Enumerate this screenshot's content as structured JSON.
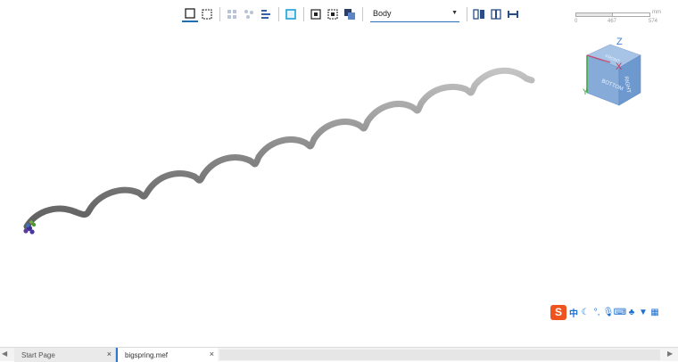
{
  "toolbar": {
    "select_value": "Body",
    "buttons": [
      {
        "name": "select-single-icon"
      },
      {
        "name": "select-box-icon"
      },
      {
        "name": "select-grid-icon"
      },
      {
        "name": "select-scatter-icon"
      },
      {
        "name": "align-list-icon"
      },
      {
        "name": "face-mode-icon"
      },
      {
        "name": "frame-1-icon"
      },
      {
        "name": "frame-2-icon"
      },
      {
        "name": "frame-3-icon"
      },
      {
        "name": "split-view-icon"
      },
      {
        "name": "column-view-icon"
      },
      {
        "name": "measure-icon"
      }
    ]
  },
  "scale": {
    "unit": "mm",
    "ticks": [
      "0",
      "467",
      "574"
    ]
  },
  "viewcube": {
    "axis_z": "Z",
    "axis_x": "X",
    "axis_y": "Y",
    "face_front": "BOTTOM",
    "face_right": "RIGHT",
    "face_top": "FRONT"
  },
  "ime": {
    "logo": "S",
    "lang": "中",
    "icons": [
      "moon-icon",
      "punct-icon",
      "mic-icon",
      "keyboard-icon",
      "skin-icon",
      "shirt-icon",
      "grid-icon"
    ]
  },
  "tabs": {
    "start_label": "Start Page",
    "file_label": "bigspring.mef",
    "close_glyph": "×"
  },
  "colors": {
    "accent": "#1f6fb5",
    "spring": "#8c8c8c",
    "cube": "#7fa7d6",
    "ime_logo": "#f0541e"
  }
}
